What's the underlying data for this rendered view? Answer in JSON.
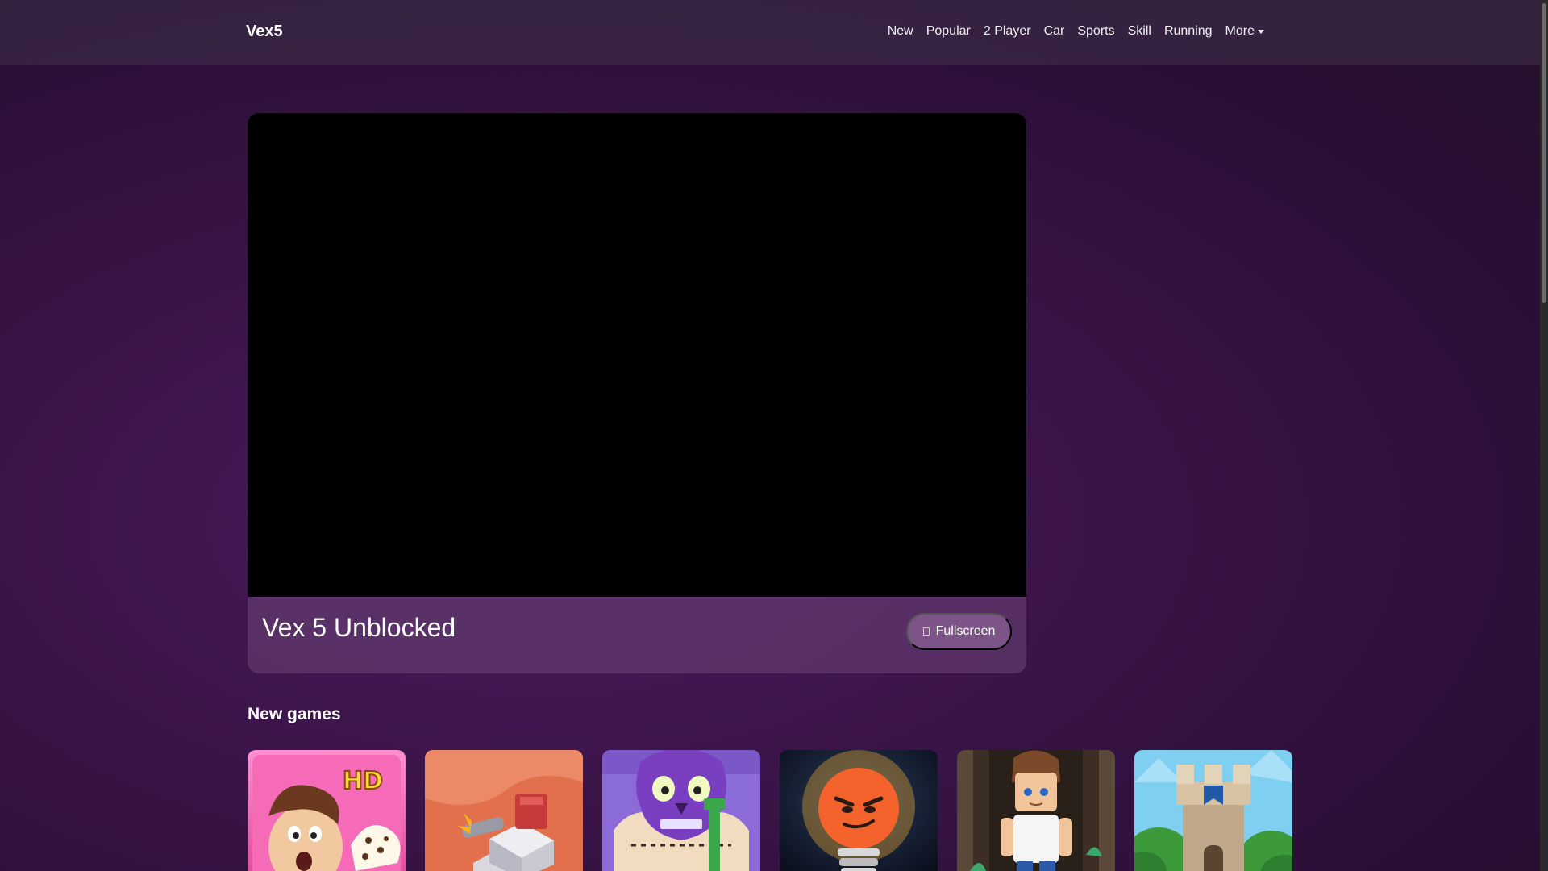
{
  "brand": "Vex5",
  "nav": {
    "links": [
      "New",
      "Popular",
      "2 Player",
      "Car",
      "Sports",
      "Skill",
      "Running"
    ],
    "more_label": "More"
  },
  "game": {
    "title": "Vex 5 Unblocked",
    "fullscreen_label": "Fullscreen"
  },
  "new_games": {
    "heading": "New games",
    "thumbnails": [
      {
        "icon": "papa-cupcake-hd-thumbnail",
        "badge": "HD"
      },
      {
        "icon": "turret-tower-thumbnail"
      },
      {
        "icon": "purple-skull-shave-thumbnail"
      },
      {
        "icon": "angry-lightbulb-thumbnail"
      },
      {
        "icon": "blocky-boy-dungeon-thumbnail"
      },
      {
        "icon": "castle-tower-thumbnail"
      }
    ]
  },
  "colors": {
    "background": "#3a1448",
    "navbar": "#3c2d46",
    "game_frame": "#000000"
  }
}
